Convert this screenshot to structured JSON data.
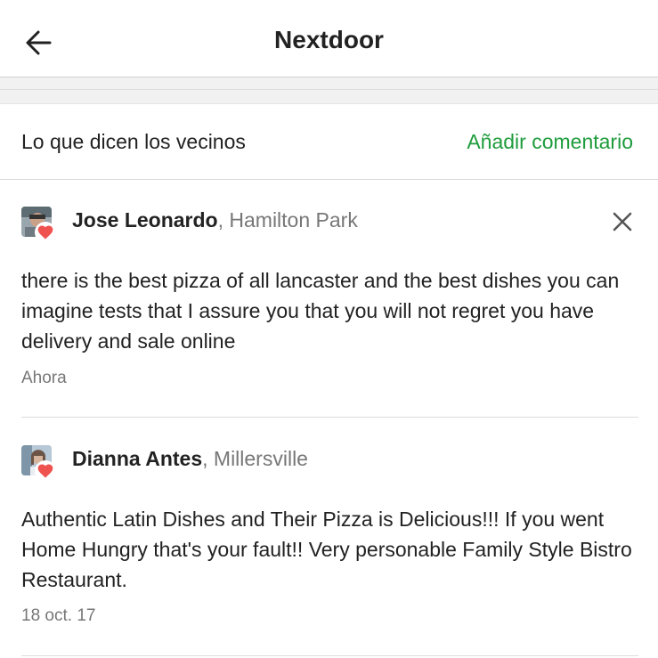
{
  "navbar": {
    "title": "Nextdoor",
    "back_icon": "arrow-left-icon"
  },
  "section": {
    "title": "Lo que dicen los vecinos",
    "add_comment_label": "Añadir comentario",
    "accent_color": "#1e9c3c"
  },
  "comments": [
    {
      "author": "Jose Leonardo",
      "separator": ", ",
      "neighborhood": "Hamilton Park",
      "text": "there is the best pizza of all lancaster and the best dishes you can imagine tests that I assure you that you will not regret you have delivery and sale online",
      "time": "Ahora",
      "reaction_icon": "heart-icon",
      "has_close": true
    },
    {
      "author": "Dianna Antes",
      "separator": ", ",
      "neighborhood": "Millersville",
      "text": "Authentic Latin Dishes and Their Pizza is Delicious!!! If you went Home Hungry that's your fault!! Very personable Family Style Bistro Restaurant.",
      "time": "18 oct. 17",
      "reaction_icon": "heart-icon",
      "has_close": false
    }
  ],
  "colors": {
    "heart": "#ef5350",
    "muted_text": "#777777"
  }
}
